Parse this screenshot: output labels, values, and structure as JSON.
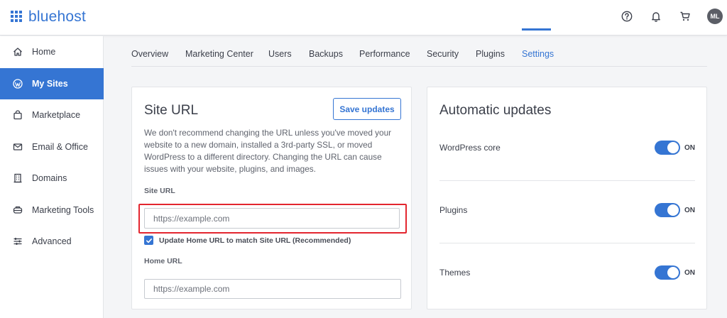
{
  "header": {
    "logo_text": "bluehost",
    "avatar_initials": "ML",
    "icons": [
      "help-icon",
      "bell-icon",
      "cart-icon"
    ]
  },
  "sidebar": {
    "items": [
      {
        "label": "Home",
        "icon": "home-icon",
        "active": false
      },
      {
        "label": "My Sites",
        "icon": "wordpress-icon",
        "active": true
      },
      {
        "label": "Marketplace",
        "icon": "shopping-bag-icon",
        "active": false
      },
      {
        "label": "Email & Office",
        "icon": "mail-icon",
        "active": false
      },
      {
        "label": "Domains",
        "icon": "building-icon",
        "active": false
      },
      {
        "label": "Marketing Tools",
        "icon": "megaphone-icon",
        "active": false
      },
      {
        "label": "Advanced",
        "icon": "sliders-icon",
        "active": false
      }
    ]
  },
  "tabs": [
    {
      "label": "Overview",
      "active": false
    },
    {
      "label": "Marketing Center",
      "active": false
    },
    {
      "label": "Users",
      "active": false
    },
    {
      "label": "Backups",
      "active": false
    },
    {
      "label": "Performance",
      "active": false
    },
    {
      "label": "Security",
      "active": false
    },
    {
      "label": "Plugins",
      "active": false
    },
    {
      "label": "Settings",
      "active": true
    }
  ],
  "site_url_card": {
    "title": "Site URL",
    "save_label": "Save updates",
    "description": "We don't recommend changing the URL unless you've moved your website to a new domain, installed a 3rd-party SSL, or moved WordPress to a different directory. Changing the URL can cause issues with your website, plugins, and images.",
    "site_url_label": "Site URL",
    "site_url_placeholder": "https://example.com",
    "checkbox_label": "Update Home URL to match Site URL (Recommended)",
    "checkbox_checked": true,
    "home_url_label": "Home URL",
    "home_url_placeholder": "https://example.com"
  },
  "auto_updates_card": {
    "title": "Automatic updates",
    "rows": [
      {
        "label": "WordPress core",
        "state": "ON"
      },
      {
        "label": "Plugins",
        "state": "ON"
      },
      {
        "label": "Themes",
        "state": "ON"
      }
    ]
  },
  "colors": {
    "brand_blue": "#3575d3",
    "highlight_red": "#e3262f"
  }
}
